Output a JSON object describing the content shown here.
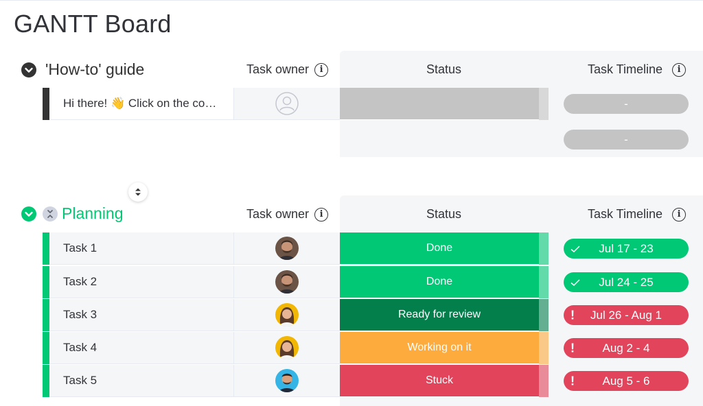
{
  "board": {
    "title": "GANTT Board"
  },
  "groups": [
    {
      "title": "'How-to' guide",
      "color": "#333333",
      "columns": {
        "owner": "Task owner",
        "status": "Status",
        "timeline": "Task Timeline"
      },
      "rows": [
        {
          "name": "Hi there! 👋 Click on the co…",
          "owner": "empty-avatar",
          "status": "",
          "status_color": "#c4c4c4",
          "timeline": "-",
          "timeline_color": "#c4c4c4"
        },
        {
          "name": "",
          "owner": "",
          "status": "",
          "status_color": "",
          "timeline": "-",
          "timeline_color": "#c4c4c4"
        }
      ]
    },
    {
      "title": "Planning",
      "color": "#00c875",
      "columns": {
        "owner": "Task owner",
        "status": "Status",
        "timeline": "Task Timeline"
      },
      "rows": [
        {
          "name": "Task 1",
          "owner": "bearded-man-avatar",
          "status": "Done",
          "status_color": "#00c875",
          "timeline": "Jul 17 - 23",
          "timeline_color": "#00c875",
          "timeline_icon": "check-icon"
        },
        {
          "name": "Task 2",
          "owner": "bearded-man-avatar",
          "status": "Done",
          "status_color": "#00c875",
          "timeline": "Jul 24 - 25",
          "timeline_color": "#00c875",
          "timeline_icon": "check-icon"
        },
        {
          "name": "Task 3",
          "owner": "woman-avatar",
          "status": "Ready for review",
          "status_color": "#037f4c",
          "timeline": "Jul 26 - Aug 1",
          "timeline_color": "#e2445c",
          "timeline_icon": "exclamation-icon"
        },
        {
          "name": "Task 4",
          "owner": "woman-avatar",
          "status": "Working on it",
          "status_color": "#fdab3d",
          "timeline": "Aug 2 - 4",
          "timeline_color": "#e2445c",
          "timeline_icon": "exclamation-icon"
        },
        {
          "name": "Task 5",
          "owner": "man-blue-avatar",
          "status": "Stuck",
          "status_color": "#e2445c",
          "timeline": "Aug 5 - 6",
          "timeline_color": "#e2445c",
          "timeline_icon": "exclamation-icon"
        }
      ]
    }
  ],
  "timeline_icons": {
    "done": "✓",
    "late": "!"
  }
}
